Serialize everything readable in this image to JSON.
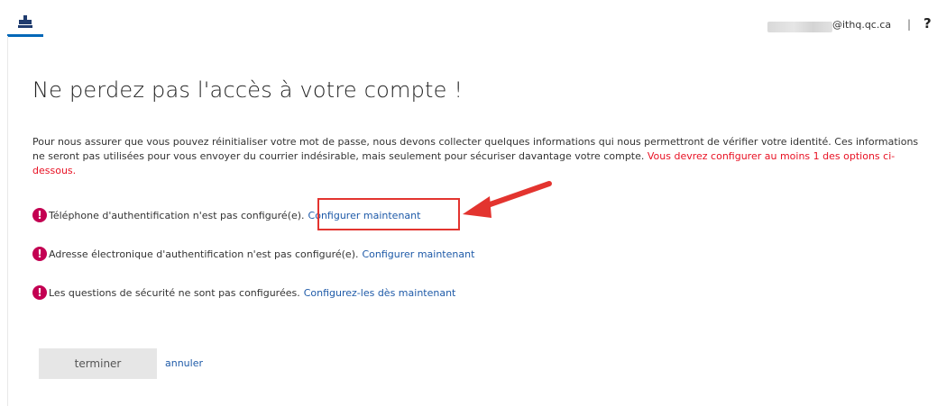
{
  "header": {
    "user_email_domain": "@ithq.qc.ca",
    "separator": "|",
    "help_label": "?"
  },
  "main": {
    "title": "Ne perdez pas l'accès à votre compte !",
    "intro_text": "Pour nous assurer que vous pouvez réinitialiser votre mot de passe, nous devons collecter quelques informations qui nous permettront de vérifier votre identité. Ces informations ne seront pas utilisées pour vous envoyer du courrier indésirable, mais seulement pour sécuriser davantage votre compte.",
    "intro_warning": "Vous devrez configurer au moins 1 des options ci-dessous.",
    "items": [
      {
        "text": "Téléphone d'authentification n'est pas configuré(e).",
        "link": "Configurer maintenant"
      },
      {
        "text": "Adresse électronique d'authentification n'est pas configuré(e).",
        "link": "Configurer maintenant"
      },
      {
        "text": "Les questions de sécurité ne sont pas configurées.",
        "link": "Configurez-les dès maintenant"
      }
    ],
    "alert_glyph": "!"
  },
  "actions": {
    "finish_label": "terminer",
    "cancel_label": "annuler"
  },
  "colors": {
    "accent": "#0067b8",
    "link": "#1e5aa8",
    "warning": "#e81123",
    "alert_badge": "#c30052",
    "annotation": "#e3342f"
  }
}
